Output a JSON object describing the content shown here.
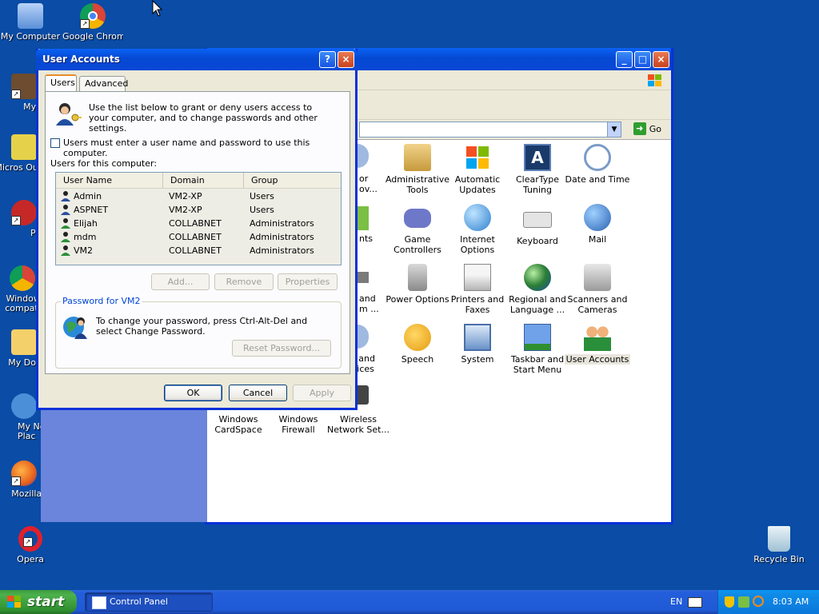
{
  "desktop": {
    "icons": [
      {
        "label": "My Computer"
      },
      {
        "label": "Google Chrome"
      },
      {
        "label": "MyPa"
      },
      {
        "label": "Micros Outlo"
      },
      {
        "label": "Peg"
      },
      {
        "label": "Windows compatib"
      },
      {
        "label": "My Docu"
      },
      {
        "label": "My Net Plac"
      },
      {
        "label": "Mozilla F"
      },
      {
        "label": "Opera"
      },
      {
        "label": "Recycle Bin"
      }
    ]
  },
  "control_panel": {
    "address_go": "Go",
    "items": [
      {
        "label": "Administrative Tools"
      },
      {
        "label": "Automatic Updates"
      },
      {
        "label": "ClearType Tuning"
      },
      {
        "label": "Date and Time"
      },
      {
        "label": "Game Controllers"
      },
      {
        "label": "Internet Options"
      },
      {
        "label": "Keyboard"
      },
      {
        "label": "Mail"
      },
      {
        "label": "Power Options"
      },
      {
        "label": "Printers and Faxes"
      },
      {
        "label": "Regional and Language ..."
      },
      {
        "label": "Scanners and Cameras"
      },
      {
        "label": "Speech"
      },
      {
        "label": "System"
      },
      {
        "label": "Taskbar and Start Menu"
      },
      {
        "label": "User Accounts"
      },
      {
        "label": "Windows CardSpace"
      },
      {
        "label": "Windows Firewall"
      },
      {
        "label": "Wireless Network Set..."
      }
    ],
    "partial_labels": [
      "or",
      "ov...",
      "nts",
      "and",
      "m ...",
      "s and",
      "evices"
    ]
  },
  "dialog": {
    "title": "User Accounts",
    "help_button": "?",
    "close_button": "×",
    "tabs": [
      {
        "label": "Users"
      },
      {
        "label": "Advanced"
      }
    ],
    "intro_text": "Use the list below to grant or deny users access to your computer, and to change passwords and other settings.",
    "checkbox_label": "Users must enter a user name and password to use this computer.",
    "users_label": "Users for this computer:",
    "columns": [
      "User Name",
      "Domain",
      "Group"
    ],
    "users": [
      {
        "name": "Admin",
        "domain": "VM2-XP",
        "group": "Users"
      },
      {
        "name": "ASPNET",
        "domain": "VM2-XP",
        "group": "Users"
      },
      {
        "name": "Elijah",
        "domain": "COLLABNET",
        "group": "Administrators"
      },
      {
        "name": "mdm",
        "domain": "COLLABNET",
        "group": "Administrators"
      },
      {
        "name": "VM2",
        "domain": "COLLABNET",
        "group": "Administrators"
      }
    ],
    "add_button": "Add...",
    "remove_button": "Remove",
    "properties_button": "Properties",
    "password_group_label": "Password for VM2",
    "password_text": "To change your password, press Ctrl-Alt-Del and select Change Password.",
    "reset_button": "Reset Password...",
    "ok_button": "OK",
    "cancel_button": "Cancel",
    "apply_button": "Apply"
  },
  "taskbar": {
    "start_label": "start",
    "task_label": "Control Panel",
    "language": "EN",
    "clock": "8:03 AM"
  }
}
